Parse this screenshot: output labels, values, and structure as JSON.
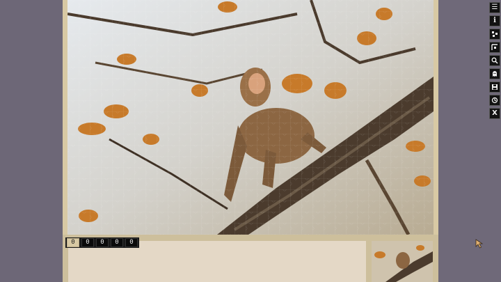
{
  "toolbar": {
    "buttons": [
      {
        "name": "menu",
        "icon": "menu-icon",
        "glyph": "☰"
      },
      {
        "name": "info",
        "icon": "info-icon",
        "glyph": "i"
      },
      {
        "name": "scatter",
        "icon": "scatter-pieces-icon",
        "glyph": ""
      },
      {
        "name": "edges",
        "icon": "edge-pieces-icon",
        "glyph": ""
      },
      {
        "name": "zoom",
        "icon": "magnifier-icon",
        "glyph": ""
      },
      {
        "name": "ghost",
        "icon": "ghost-image-icon",
        "glyph": ""
      },
      {
        "name": "save",
        "icon": "save-icon",
        "glyph": ""
      },
      {
        "name": "rotate",
        "icon": "rotate-icon",
        "glyph": ""
      },
      {
        "name": "close",
        "icon": "close-icon",
        "glyph": "X"
      }
    ]
  },
  "counter": {
    "digits": [
      "0",
      "0",
      "0",
      "0",
      "0"
    ]
  },
  "colors": {
    "background": "#6e6878",
    "frame": "#d8c9a4",
    "tray": "#e4d8c6",
    "toolbar_button": "#121212"
  },
  "puzzle": {
    "subject": "monkey-on-branch-autumn-leaves"
  }
}
